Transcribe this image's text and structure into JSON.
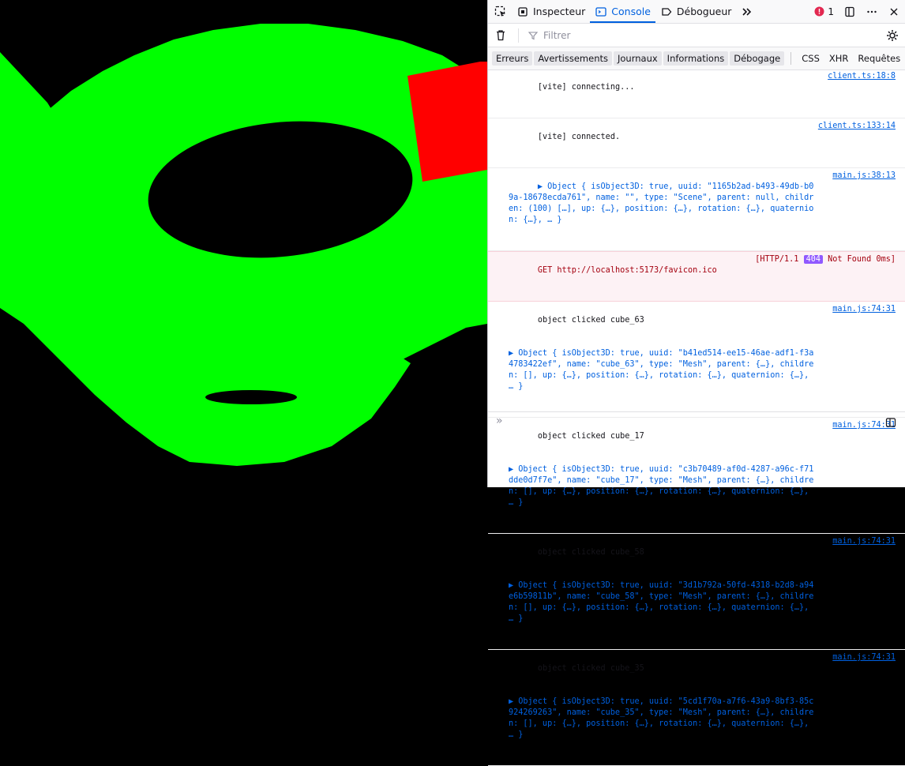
{
  "toolbar": {
    "tabs": [
      {
        "label": "Inspecteur",
        "icon": "inspector-icon"
      },
      {
        "label": "Console",
        "icon": "console-icon"
      },
      {
        "label": "Débogueur",
        "icon": "debugger-icon"
      }
    ],
    "error_count": "1"
  },
  "filter": {
    "placeholder": "Filtrer"
  },
  "categories": [
    "Erreurs",
    "Avertissements",
    "Journaux",
    "Informations",
    "Débogage"
  ],
  "net_categories": [
    "CSS",
    "XHR",
    "Requêtes"
  ],
  "messages": [
    {
      "text": "[vite] connecting...",
      "source": "client.ts:18:8"
    },
    {
      "text": "[vite] connected.",
      "source": "client.ts:133:14"
    },
    {
      "text": "▶ Object { isObject3D: true, uuid: \"1165b2ad-b493-49db-b09a-18678ecda761\", name: \"\", type: \"Scene\", parent: null, children: (100) […], up: {…}, position: {…}, rotation: {…}, quaternion: {…}, … }",
      "source": "main.js:38:13"
    },
    {
      "text": "GET http://localhost:5173/favicon.ico",
      "status": "[HTTP/1.1 404 Not Found 0ms]",
      "status_code": "404"
    },
    {
      "text": "object clicked cube_63",
      "detail": "▶ Object { isObject3D: true, uuid: \"b41ed514-ee15-46ae-adf1-f3a4783422ef\", name: \"cube_63\", type: \"Mesh\", parent: {…}, children: [], up: {…}, position: {…}, rotation: {…}, quaternion: {…}, … }",
      "source": "main.js:74:31"
    },
    {
      "text": "object clicked cube_17",
      "detail": "▶ Object { isObject3D: true, uuid: \"c3b70489-af0d-4287-a96c-f71dde0d7f7e\", name: \"cube_17\", type: \"Mesh\", parent: {…}, children: [], up: {…}, position: {…}, rotation: {…}, quaternion: {…}, … }",
      "source": "main.js:74:31"
    },
    {
      "text": "object clicked cube_58",
      "detail": "▶ Object { isObject3D: true, uuid: \"3d1b792a-50fd-4318-b2d8-a94e6b59811b\", name: \"cube_58\", type: \"Mesh\", parent: {…}, children: [], up: {…}, position: {…}, rotation: {…}, quaternion: {…}, … }",
      "source": "main.js:74:31"
    },
    {
      "text": "object clicked cube_35",
      "detail": "▶ Object { isObject3D: true, uuid: \"5cd1f70a-a7f6-43a9-8bf3-85c924269263\", name: \"cube_35\", type: \"Mesh\", parent: {…}, children: [], up: {…}, position: {…}, rotation: {…}, quaternion: {…}, … }",
      "source": "main.js:74:31"
    }
  ],
  "prompt": "»",
  "colors": {
    "torus": "#00ff00",
    "selected_cube": "#ff0000",
    "background": "#000000",
    "accent": "#0060df"
  }
}
